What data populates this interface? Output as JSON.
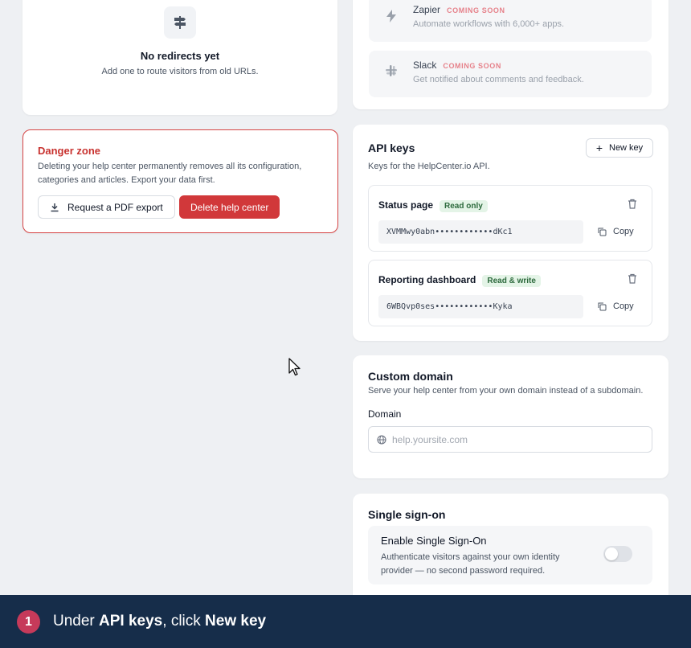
{
  "redirects": {
    "empty_icon": "signpost-icon",
    "empty_title": "No redirects yet",
    "empty_subtitle": "Add one to route visitors from old URLs."
  },
  "danger_zone": {
    "title": "Danger zone",
    "description": "Deleting your help center permanently removes all its configuration, categories and articles. Export your data first.",
    "export_button": "Request a PDF export",
    "delete_button": "Delete help center",
    "accent_color": "#d1383a"
  },
  "integrations": {
    "items": [
      {
        "name": "Zapier",
        "badge": "COMING SOON",
        "description": "Automate workflows with 6,000+ apps.",
        "icon": "bolt-icon"
      },
      {
        "name": "Slack",
        "badge": "COMING SOON",
        "description": "Get notified about comments and feedback.",
        "icon": "slack-icon"
      }
    ]
  },
  "api_keys": {
    "title": "API keys",
    "subtitle": "Keys for the HelpCenter.io API.",
    "new_key_label": "New key",
    "copy_label": "Copy",
    "keys": [
      {
        "name": "Status page",
        "permission": "Read only",
        "value": "XVMMwy0abn••••••••••••dKc1"
      },
      {
        "name": "Reporting dashboard",
        "permission": "Read & write",
        "value": "6WBQvp0ses••••••••••••Kyka"
      }
    ]
  },
  "custom_domain": {
    "title": "Custom domain",
    "subtitle": "Serve your help center from your own domain instead of a subdomain.",
    "field_label": "Domain",
    "placeholder": "help.yoursite.com",
    "value": ""
  },
  "sso": {
    "title": "Single sign-on",
    "option_title": "Enable Single Sign-On",
    "option_description": "Authenticate visitors against your own identity provider — no second password required.",
    "enabled": false
  },
  "instruction": {
    "step_number": "1",
    "prefix": "Under ",
    "section": "API keys",
    "middle": ", click ",
    "target": "New key",
    "bar_color": "#162d4a",
    "badge_color": "#c63a5a"
  }
}
